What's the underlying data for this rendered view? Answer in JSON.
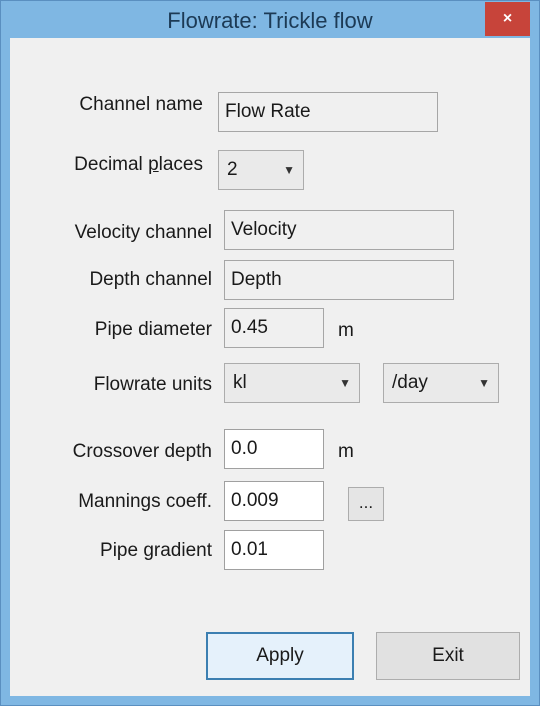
{
  "window": {
    "title": "Flowrate: Trickle flow",
    "close_glyph": "×"
  },
  "form": {
    "channel_name": {
      "label": "Channel name",
      "value": "Flow Rate"
    },
    "decimal_places": {
      "label_pre": "Decimal ",
      "label_accel": "p",
      "label_post": "laces",
      "value": "2"
    },
    "velocity_channel": {
      "label": "Velocity channel",
      "value": "Velocity"
    },
    "depth_channel": {
      "label": "Depth channel",
      "value": "Depth"
    },
    "pipe_diameter": {
      "label": "Pipe diameter",
      "value": "0.45",
      "unit": "m"
    },
    "flowrate_units": {
      "label": "Flowrate units",
      "volume_value": "kl",
      "time_value": "/day"
    },
    "crossover_depth": {
      "label": "Crossover depth",
      "value": "0.0",
      "unit": "m"
    },
    "mannings_coeff": {
      "label": "Mannings coeff.",
      "value": "0.009",
      "browse_label": "..."
    },
    "pipe_gradient": {
      "label": "Pipe gradient",
      "value": "0.01"
    }
  },
  "buttons": {
    "apply": "Apply",
    "exit": "Exit"
  },
  "icons": {
    "dropdown": "chevron-down-icon"
  }
}
